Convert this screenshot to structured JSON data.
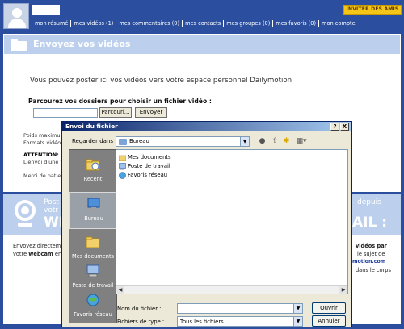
{
  "header": {
    "invite_label": "INVITER DES AMIS",
    "nav": [
      "mon résumé",
      "mes vidéos (1)",
      "mes commentaires (0)",
      "mes contacts",
      "mes groupes (0)",
      "mes favoris (0)",
      "mon compte"
    ]
  },
  "main": {
    "section_title": "Envoyez vos vidéos",
    "intro": "Vous pouvez poster ici vos vidéos vers votre espace personnel Dailymotion",
    "browse_label": "Parcourez vos dossiers pour choisir un fichier vidéo :",
    "browse_button": "Parcouri...",
    "send_button": "Envoyer",
    "poids_text": "Poids maximum",
    "formats_text": "Formats vidéo c",
    "attention_text": "ATTENTION: L'",
    "envoi_text": "L'envoi d'une vid",
    "patience_text": "Merci de patient"
  },
  "webcam_section": {
    "line1_left": "Post",
    "line2_left": "votr",
    "big_left": "WE",
    "line1_right": "depuis",
    "big_right": "AIL :",
    "text_left_1": "Envoyez directem",
    "text_left_2_bold": "webcam",
    "text_left_2_pre": "votre",
    "text_left_2_post": "en",
    "right_bold": "vidéos par",
    "right_line2": "le sujet de",
    "right_link": "motion.com",
    "right_line4": "dans le corps"
  },
  "dialog": {
    "title": "Envoi du fichier",
    "help_btn": "?",
    "close_btn": "X",
    "lookin_label": "Regarder dans :",
    "lookin_value": "Bureau",
    "places": [
      "Recent",
      "Bureau",
      "Mes documents",
      "Poste de travail",
      "Favoris réseau"
    ],
    "items": [
      "Mes documents",
      "Poste de travail",
      "Favoris réseau"
    ],
    "filename_label": "Nom du fichier :",
    "filename_value": "",
    "filetype_label": "Fichiers de type :",
    "filetype_value": "Tous les fichiers",
    "open_button": "Ouvrir",
    "cancel_button": "Annuler"
  }
}
